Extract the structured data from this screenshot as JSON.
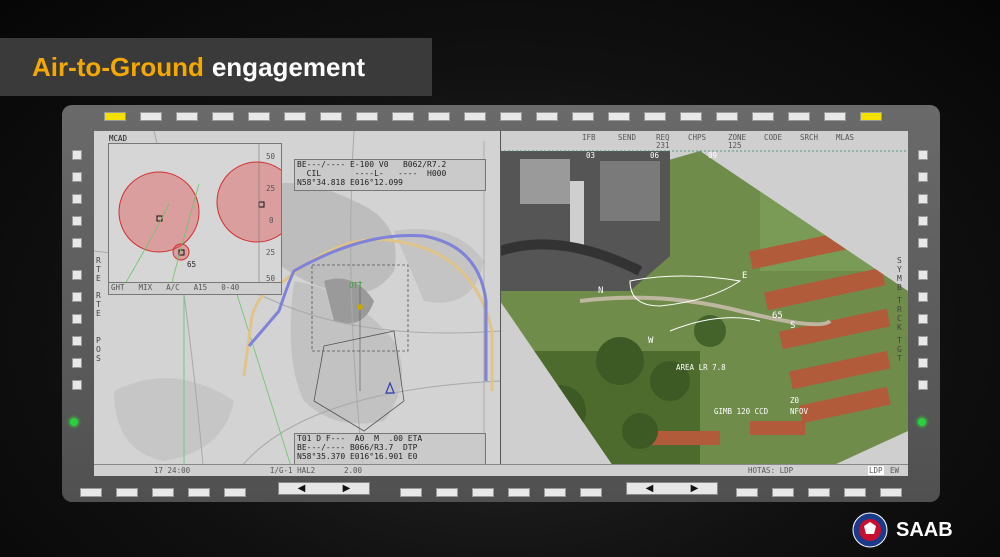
{
  "title": {
    "part1": "Air-to-Ground",
    "part2": "engagement"
  },
  "top_softkeys": [
    {
      "label": "IFB",
      "sub": ""
    },
    {
      "label": "SEND",
      "sub": ""
    },
    {
      "label": "REQ",
      "sub": "231"
    },
    {
      "label": "CHPS",
      "sub": ""
    },
    {
      "label": "ZONE",
      "sub": "125"
    },
    {
      "label": "CODE",
      "sub": ""
    },
    {
      "label": "SRCH",
      "sub": ""
    },
    {
      "label": "MLAS",
      "sub": ""
    }
  ],
  "left_softkeys": [
    "RTE",
    "RTE",
    "POS"
  ],
  "right_softkeys": [
    "SYMB",
    "TRCK",
    "TGT"
  ],
  "map_header": {
    "line1": "BE---/---- E-100 V0   B062/R7.2",
    "line2": "  CIL       ----L-   ----  H000",
    "line3": "N58°34.818 E016°12.099"
  },
  "map_footer": {
    "line1": "T01 D F---  A0  M  .00 ETA",
    "line2": "BE---/---- B066/R3.7  DTP",
    "line3": "N58°35.370 E016°16.901 E0"
  },
  "inset": {
    "label_left": "GHT",
    "label_mid": "MIX",
    "label_ac": "A/C",
    "label_range": "A15",
    "label_ranges": "0-40",
    "tag": "MCAD"
  },
  "inset_ticks": [
    "50",
    "25",
    "0",
    "25",
    "50"
  ],
  "waypoint_labels": [
    "65",
    "OTT"
  ],
  "bottom_bar": {
    "time": "17 24:00",
    "mode": "I/G-1 HAL2",
    "value": "2.00",
    "hotas": "HOTAS: LDP",
    "ldp": "LDP",
    "ew": "EW"
  },
  "camera": {
    "heading_ticks": [
      "03",
      "06",
      "09"
    ],
    "compass": [
      "N",
      "E",
      "S",
      "W"
    ],
    "readout_area": "AREA   LR 7.8",
    "readout_gimb": "GIMB 120 CCD",
    "readout_z": "Z0",
    "readout_nfov": "NFOV",
    "target_label": "65"
  },
  "brand": "SAAB",
  "colors": {
    "accent": "#f5a800",
    "route_blue": "#7e82d8",
    "route_tan": "#e0c48a",
    "threat_red": "#e25a5a"
  }
}
